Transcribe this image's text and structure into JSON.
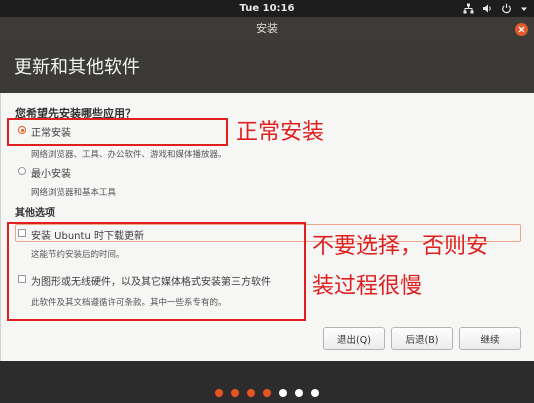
{
  "topbar": {
    "clock": "Tue 10:16"
  },
  "window": {
    "title": "安装"
  },
  "header": {
    "title": "更新和其他软件"
  },
  "question": "您希望先安装哪些应用？",
  "install_options": [
    {
      "label": "正常安装",
      "desc": "网络浏览器、工具、办公软件、游戏和媒体播放器。",
      "selected": true
    },
    {
      "label": "最小安装",
      "desc": "网络浏览器和基本工具",
      "selected": false
    }
  ],
  "other_options": {
    "title": "其他选项",
    "items": [
      {
        "label": "安装 Ubuntu 时下载更新",
        "desc": "这能节约安装后的时间。",
        "checked": false
      },
      {
        "label": "为图形或无线硬件，以及其它媒体格式安装第三方软件",
        "desc": "此软件及其文档遵循许可条款。其中一些系专有的。",
        "checked": false
      }
    ]
  },
  "buttons": {
    "quit": "退出(Q)",
    "back": "后退(B)",
    "continue": "继续"
  },
  "annotations": {
    "normal": "正常安装",
    "warning_line1": "不要选择，否则安",
    "warning_line2": "装过程很慢"
  },
  "progress": {
    "total_steps": 7,
    "current_step": 4
  },
  "colors": {
    "accent": "#e95420",
    "annotation": "#e01f1f"
  }
}
